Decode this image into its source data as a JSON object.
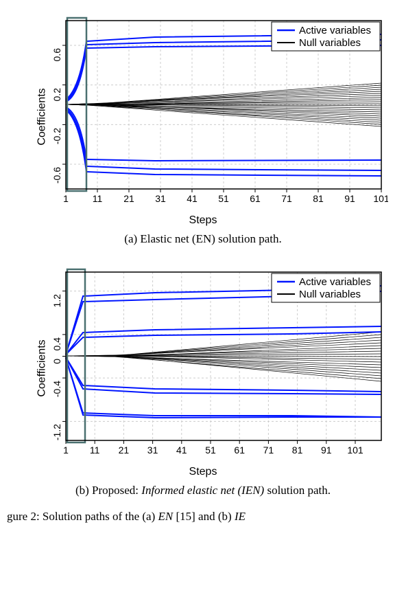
{
  "chart_data": [
    {
      "type": "line",
      "title": "",
      "xlabel": "Steps",
      "ylabel": "Coefficients",
      "x_ticks": [
        1,
        11,
        21,
        31,
        41,
        51,
        61,
        71,
        81,
        91,
        101
      ],
      "y_ticks": [
        -0.6,
        -0.2,
        0.2,
        0.6
      ],
      "xlim": [
        1,
        101
      ],
      "ylim": [
        -0.85,
        0.85
      ],
      "highlight_range": [
        1,
        7
      ],
      "legend": [
        {
          "label": "Active variables",
          "color": "#0015ff"
        },
        {
          "label": "Null variables",
          "color": "#000000"
        }
      ],
      "series": [
        {
          "name": "Active variables",
          "group": "active",
          "paths_summary": "≈6 blue curves diverging rapidly in steps 1–8 to ≈ ±0.55 to ±0.7 then drifting slowly toward ±0.58 to ±0.72 by step 101"
        },
        {
          "name": "Null variables",
          "group": "null",
          "paths_summary": "many black curves staying near 0 through ~step 8, then fanning out roughly linearly to a band ≈ [-0.22, 0.22] at step 101"
        }
      ],
      "caption": "(a) Elastic net (EN) solution path."
    },
    {
      "type": "line",
      "title": "",
      "xlabel": "Steps",
      "ylabel": "Coefficients",
      "x_ticks": [
        1,
        11,
        21,
        31,
        41,
        51,
        61,
        71,
        81,
        91,
        101
      ],
      "y_ticks": [
        -1.2,
        -0.4,
        0,
        0.4,
        1.2
      ],
      "xlim": [
        1,
        110
      ],
      "ylim": [
        -1.55,
        1.55
      ],
      "highlight_range": [
        1,
        7
      ],
      "legend": [
        {
          "label": "Active variables",
          "color": "#0015ff"
        },
        {
          "label": "Null variables",
          "color": "#000000"
        }
      ],
      "series": [
        {
          "name": "Active variables",
          "group": "active",
          "paths_summary": "≈8 blue curves diverging rapidly in first ~8 steps to ≈ ±0.4..±1.15, then drifting; magnitudes at step 110 ≈ {1.3, 1.2, 0.55, 0.45, -0.65, -0.7, -1.12, -1.12}"
        },
        {
          "name": "Null variables",
          "group": "null",
          "paths_summary": "many black curves near 0 until ~step 15–20 then fanning to a band ≈ [-0.45, 0.45] at step 110"
        }
      ],
      "caption": "(b) Proposed: Informed elastic net (IEN) solution path."
    }
  ],
  "bottom_caption_fragment": "gure 2: Solution paths of the (a) EN [15] and (b) IE"
}
